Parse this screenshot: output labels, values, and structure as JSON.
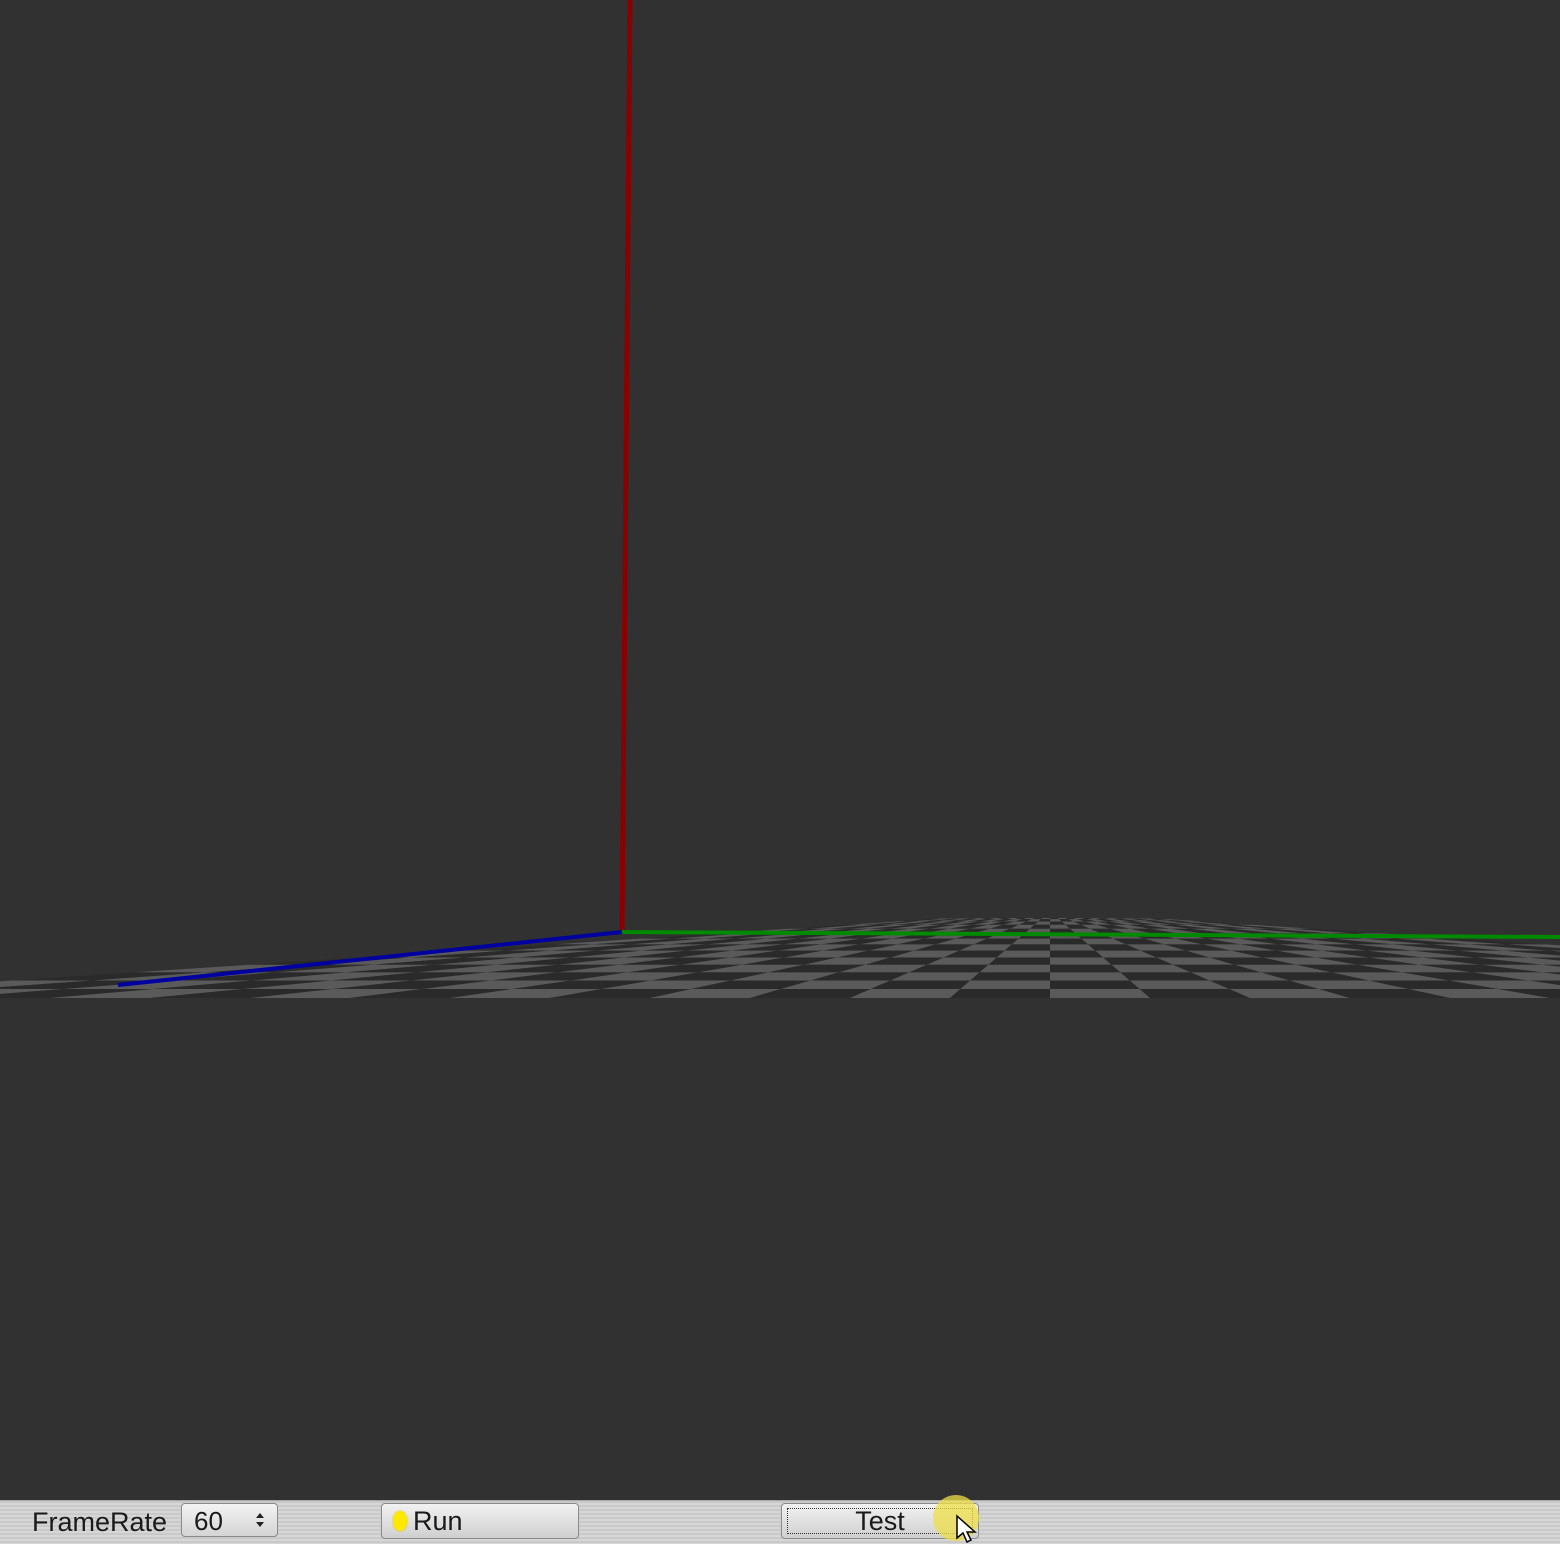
{
  "scene": {
    "background_color": "#313131",
    "axis_colors": {
      "x": "#0000a0",
      "y": "#8b0000",
      "z": "#008a00"
    },
    "floor_colors": [
      "#2a2a2a",
      "#5a5a5a",
      "#444444"
    ]
  },
  "toolbar": {
    "framerate_label": "FrameRate",
    "framerate_value": "60",
    "run_label": "Run",
    "test_label": "Test",
    "run_indicator_color": "#ffe800"
  },
  "icons": {
    "framerate_spinner": "up-down-arrows-icon",
    "run_indicator": "yellow-lamp-icon",
    "cursor": "mouse-pointer-icon"
  }
}
